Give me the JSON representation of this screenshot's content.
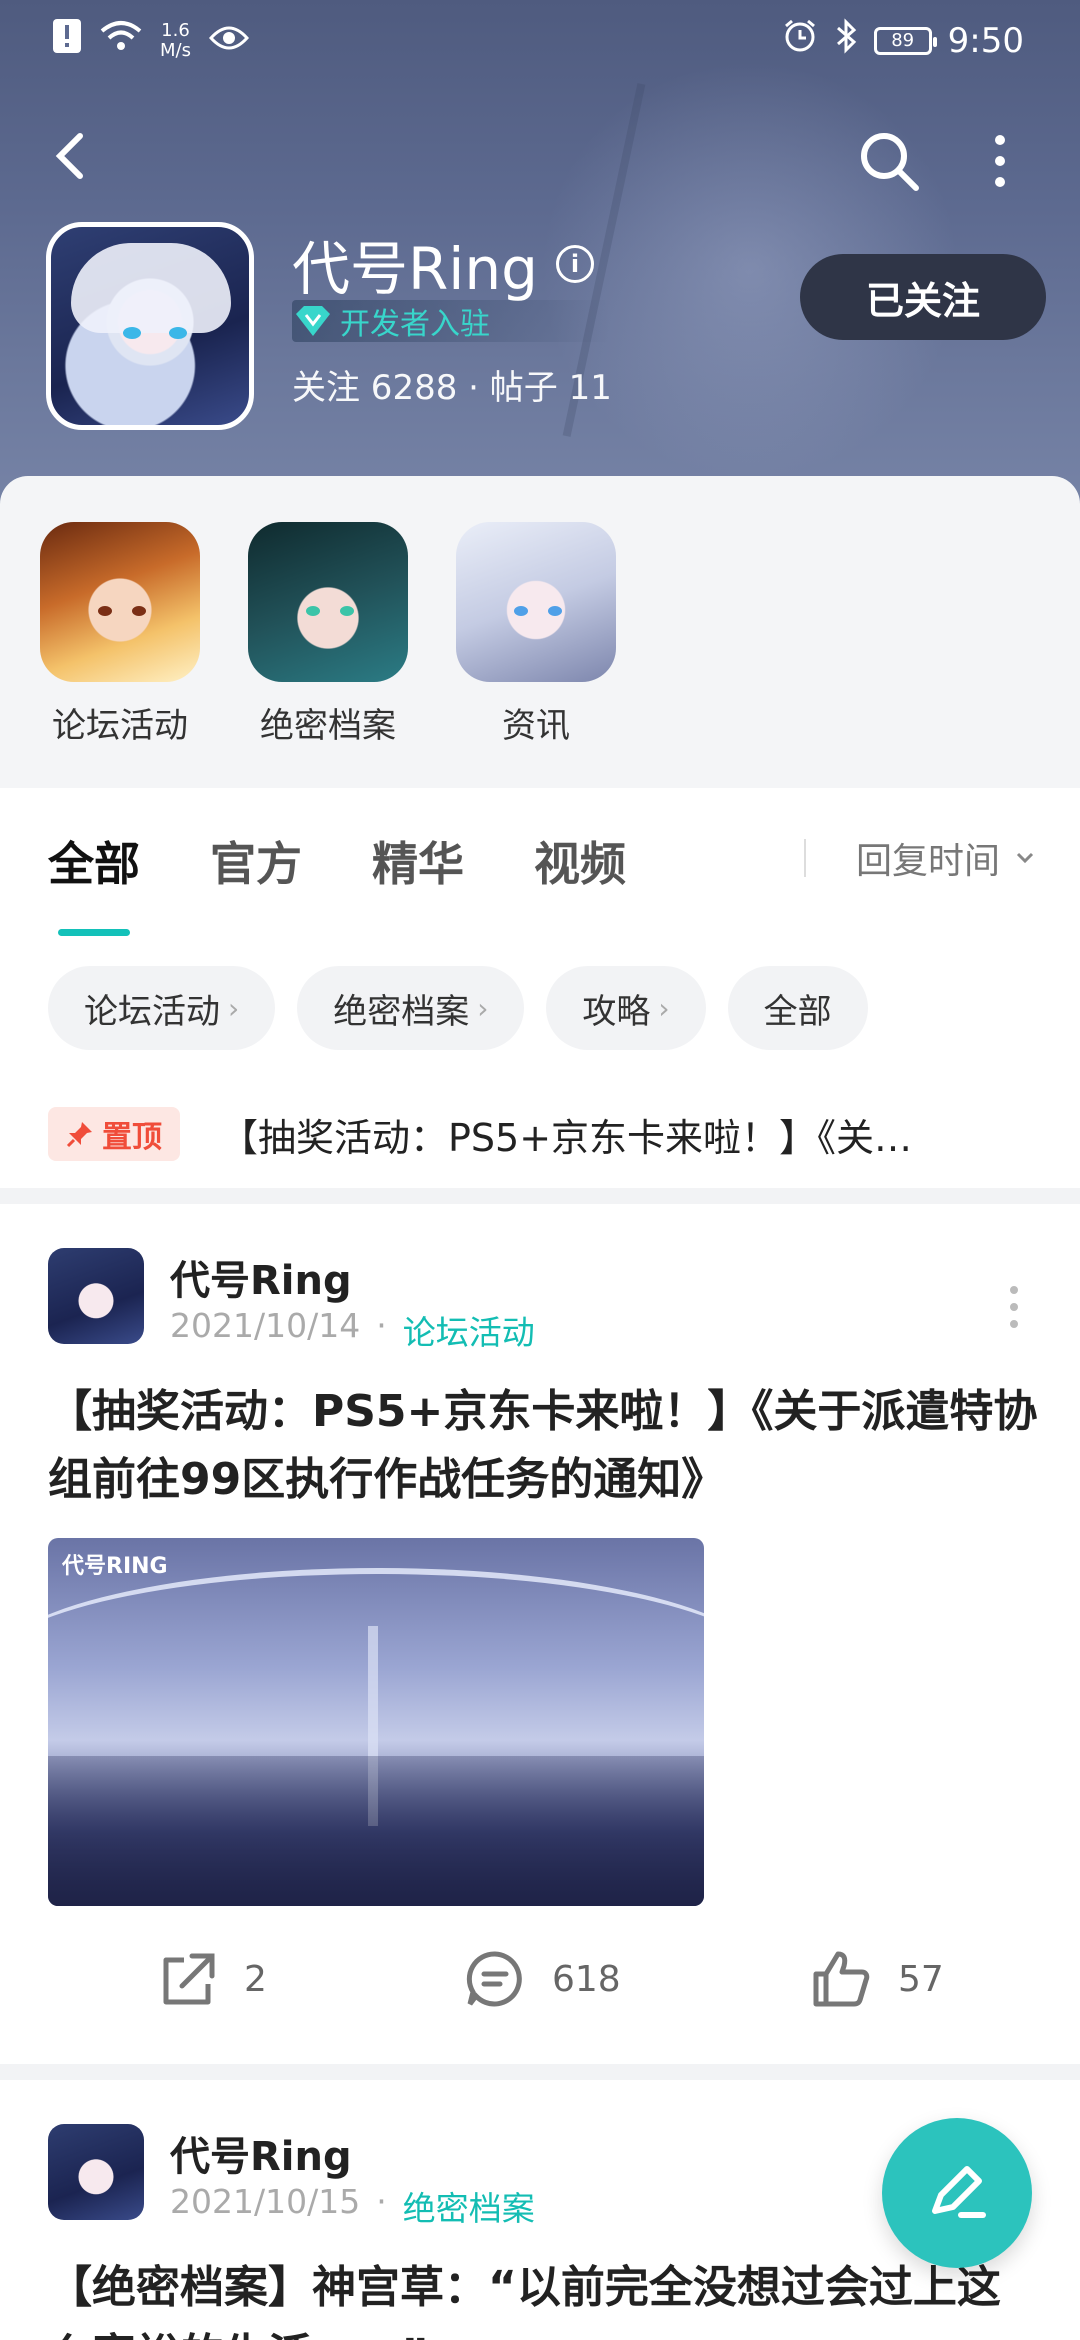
{
  "status_bar": {
    "speed_value": "1.6",
    "speed_unit": "M/s",
    "battery": "89",
    "time": "9:50"
  },
  "profile": {
    "name": "代号Ring",
    "badge": "开发者入驻",
    "stats": "关注 6288 · 帖子 11",
    "follow_button": "已关注"
  },
  "shortcuts": [
    {
      "label": "论坛活动"
    },
    {
      "label": "绝密档案"
    },
    {
      "label": "资讯"
    }
  ],
  "tabs": [
    {
      "label": "全部",
      "active": true
    },
    {
      "label": "官方",
      "active": false
    },
    {
      "label": "精华",
      "active": false
    },
    {
      "label": "视频",
      "active": false
    }
  ],
  "sort_label": "回复时间",
  "chips": [
    {
      "label": "论坛活动",
      "arrow": "›"
    },
    {
      "label": "绝密档案",
      "arrow": "›"
    },
    {
      "label": "攻略",
      "arrow": "›"
    },
    {
      "label": "全部",
      "arrow": ""
    }
  ],
  "pinned": {
    "badge": "置顶",
    "title": "【抽奖活动：PS5+京东卡来啦！】《关…"
  },
  "posts": [
    {
      "author": "代号Ring",
      "date": "2021/10/14",
      "dot": "·",
      "category": "论坛活动",
      "title": "【抽奖活动：PS5+京东卡来啦！】《关于派遣特协组前往99区执行作战任务的通知》",
      "cover_logo": "代号RING",
      "shares": "2",
      "comments": "618",
      "likes": "57"
    },
    {
      "author": "代号Ring",
      "date": "2021/10/15",
      "dot": "·",
      "category": "绝密档案",
      "title": "【绝密档案】神宫草：“以前完全没想过会过上这么富裕的生活……”"
    }
  ],
  "colors": {
    "accent": "#13c1b9",
    "pin_red": "#f04d3a",
    "header_bg": "#5d6a90"
  }
}
